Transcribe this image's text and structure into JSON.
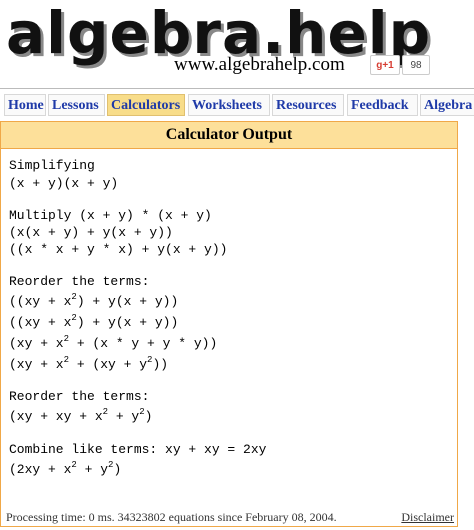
{
  "header": {
    "logo_text": "algebra.help",
    "site_url": "www.algebrahelp.com",
    "gplus_label": "g+1",
    "gplus_count": "98"
  },
  "nav": {
    "items": [
      "Home",
      "Lessons",
      "Calculators",
      "Worksheets",
      "Resources",
      "Feedback",
      "Algebra"
    ],
    "active": "Calculators"
  },
  "panel": {
    "title": "Calculator Output",
    "lines": {
      "simplifying_label": "Simplifying",
      "simplifying_expr": "(x + y)(x + y)",
      "multiply_label": "Multiply (x + y) * (x + y)",
      "multiply_step1": "(x(x + y) + y(x + y))",
      "multiply_step2": "((x * x + y * x) + y(x + y))",
      "reorder1_label": "Reorder the terms:",
      "reorder1_step1_a": "((xy + x",
      "reorder1_step1_b": ") + y(x + y))",
      "reorder1_step2_a": "((xy + x",
      "reorder1_step2_b": ") + y(x + y))",
      "reorder1_step3_a": "(xy + x",
      "reorder1_step3_b": " + (x * y + y * y))",
      "reorder1_step4_a": "(xy + x",
      "reorder1_step4_b": " + (xy + y",
      "reorder1_step4_c": "))",
      "reorder2_label": "Reorder the terms:",
      "reorder2_step_a": "(xy + xy + x",
      "reorder2_step_b": " + y",
      "reorder2_step_c": ")",
      "combine_label": "Combine like terms: xy + xy = 2xy",
      "combine_step_a": "(2xy + x",
      "combine_step_b": " + y",
      "combine_step_c": ")",
      "exp": "2"
    }
  },
  "footer": {
    "processing": "Processing time: 0 ms. 34323802 equations since February 08, 2004.",
    "disclaimer": "Disclaimer"
  }
}
